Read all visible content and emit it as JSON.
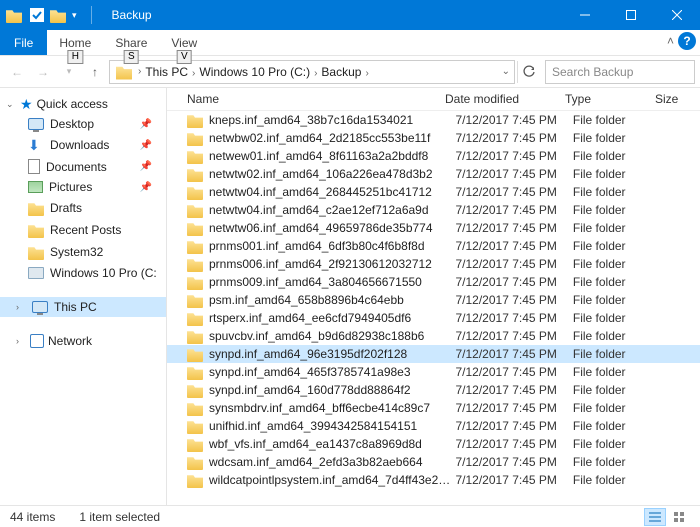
{
  "window": {
    "title": "Backup"
  },
  "ribbon": {
    "file": "File",
    "tabs": [
      {
        "label": "Home",
        "key": "H"
      },
      {
        "label": "Share",
        "key": "S"
      },
      {
        "label": "View",
        "key": "V"
      }
    ]
  },
  "breadcrumbs": [
    "This PC",
    "Windows 10 Pro (C:)",
    "Backup"
  ],
  "search_placeholder": "Search Backup",
  "columns": {
    "name": "Name",
    "date": "Date modified",
    "type": "Type",
    "size": "Size"
  },
  "sidebar": {
    "quick_access": {
      "label": "Quick access"
    },
    "quick_items": [
      {
        "label": "Desktop",
        "icon": "desktop",
        "pinned": true
      },
      {
        "label": "Downloads",
        "icon": "downloads",
        "pinned": true
      },
      {
        "label": "Documents",
        "icon": "documents",
        "pinned": true
      },
      {
        "label": "Pictures",
        "icon": "pictures",
        "pinned": true
      },
      {
        "label": "Drafts",
        "icon": "folder",
        "pinned": false
      },
      {
        "label": "Recent Posts",
        "icon": "folder",
        "pinned": false
      },
      {
        "label": "System32",
        "icon": "folder",
        "pinned": false
      },
      {
        "label": "Windows 10 Pro (C:",
        "icon": "drive",
        "pinned": false
      }
    ],
    "this_pc": {
      "label": "This PC"
    },
    "network": {
      "label": "Network"
    }
  },
  "files": [
    {
      "name": "kneps.inf_amd64_38b7c16da1534021",
      "date": "7/12/2017 7:45 PM",
      "type": "File folder"
    },
    {
      "name": "netwbw02.inf_amd64_2d2185cc553be11f",
      "date": "7/12/2017 7:45 PM",
      "type": "File folder"
    },
    {
      "name": "netwew01.inf_amd64_8f61163a2a2bddf8",
      "date": "7/12/2017 7:45 PM",
      "type": "File folder"
    },
    {
      "name": "netwtw02.inf_amd64_106a226ea478d3b2",
      "date": "7/12/2017 7:45 PM",
      "type": "File folder"
    },
    {
      "name": "netwtw04.inf_amd64_268445251bc41712",
      "date": "7/12/2017 7:45 PM",
      "type": "File folder"
    },
    {
      "name": "netwtw04.inf_amd64_c2ae12ef712a6a9d",
      "date": "7/12/2017 7:45 PM",
      "type": "File folder"
    },
    {
      "name": "netwtw06.inf_amd64_49659786de35b774",
      "date": "7/12/2017 7:45 PM",
      "type": "File folder"
    },
    {
      "name": "prnms001.inf_amd64_6df3b80c4f6b8f8d",
      "date": "7/12/2017 7:45 PM",
      "type": "File folder"
    },
    {
      "name": "prnms006.inf_amd64_2f92130612032712",
      "date": "7/12/2017 7:45 PM",
      "type": "File folder"
    },
    {
      "name": "prnms009.inf_amd64_3a804656671550",
      "date": "7/12/2017 7:45 PM",
      "type": "File folder"
    },
    {
      "name": "psm.inf_amd64_658b8896b4c64ebb",
      "date": "7/12/2017 7:45 PM",
      "type": "File folder"
    },
    {
      "name": "rtsperx.inf_amd64_ee6cfd7949405df6",
      "date": "7/12/2017 7:45 PM",
      "type": "File folder"
    },
    {
      "name": "spuvcbv.inf_amd64_b9d6d82938c188b6",
      "date": "7/12/2017 7:45 PM",
      "type": "File folder"
    },
    {
      "name": "synpd.inf_amd64_96e3195df202f128",
      "date": "7/12/2017 7:45 PM",
      "type": "File folder",
      "selected": true
    },
    {
      "name": "synpd.inf_amd64_465f3785741a98e3",
      "date": "7/12/2017 7:45 PM",
      "type": "File folder"
    },
    {
      "name": "synpd.inf_amd64_160d778dd88864f2",
      "date": "7/12/2017 7:45 PM",
      "type": "File folder"
    },
    {
      "name": "synsmbdrv.inf_amd64_bff6ecbe414c89c7",
      "date": "7/12/2017 7:45 PM",
      "type": "File folder"
    },
    {
      "name": "unifhid.inf_amd64_3994342584154151",
      "date": "7/12/2017 7:45 PM",
      "type": "File folder"
    },
    {
      "name": "wbf_vfs.inf_amd64_ea1437c8a8969d8d",
      "date": "7/12/2017 7:45 PM",
      "type": "File folder"
    },
    {
      "name": "wdcsam.inf_amd64_2efd3a3b82aeb664",
      "date": "7/12/2017 7:45 PM",
      "type": "File folder"
    },
    {
      "name": "wildcatpointlpsystem.inf_amd64_7d4ff43e23a2...",
      "date": "7/12/2017 7:45 PM",
      "type": "File folder"
    }
  ],
  "status": {
    "count": "44 items",
    "selection": "1 item selected"
  }
}
